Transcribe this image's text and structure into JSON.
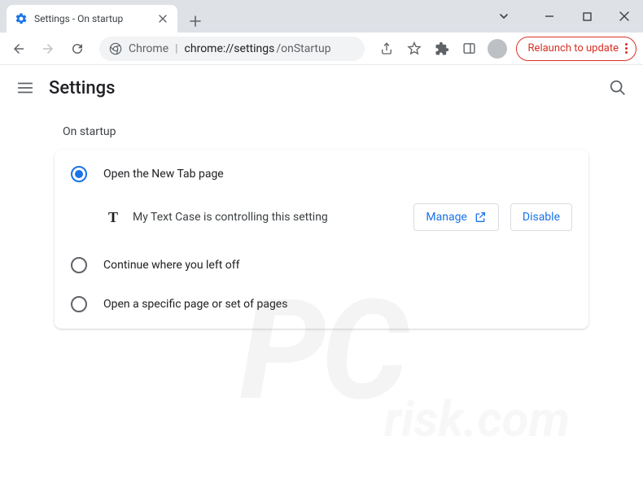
{
  "window": {
    "tab_title": "Settings - On startup"
  },
  "omnibox": {
    "app_label": "Chrome",
    "url_host": "chrome://settings",
    "url_path": "/onStartup"
  },
  "toolbar": {
    "relaunch_label": "Relaunch to update"
  },
  "header": {
    "title": "Settings"
  },
  "section": {
    "label": "On startup",
    "options": [
      {
        "label": "Open the New Tab page",
        "selected": true
      },
      {
        "label": "Continue where you left off",
        "selected": false
      },
      {
        "label": "Open a specific page or set of pages",
        "selected": false
      }
    ],
    "extension": {
      "name": "My Text Case is controlling this setting",
      "manage_label": "Manage",
      "disable_label": "Disable"
    }
  },
  "watermark": {
    "main": "PC",
    "sub": "risk.com"
  }
}
